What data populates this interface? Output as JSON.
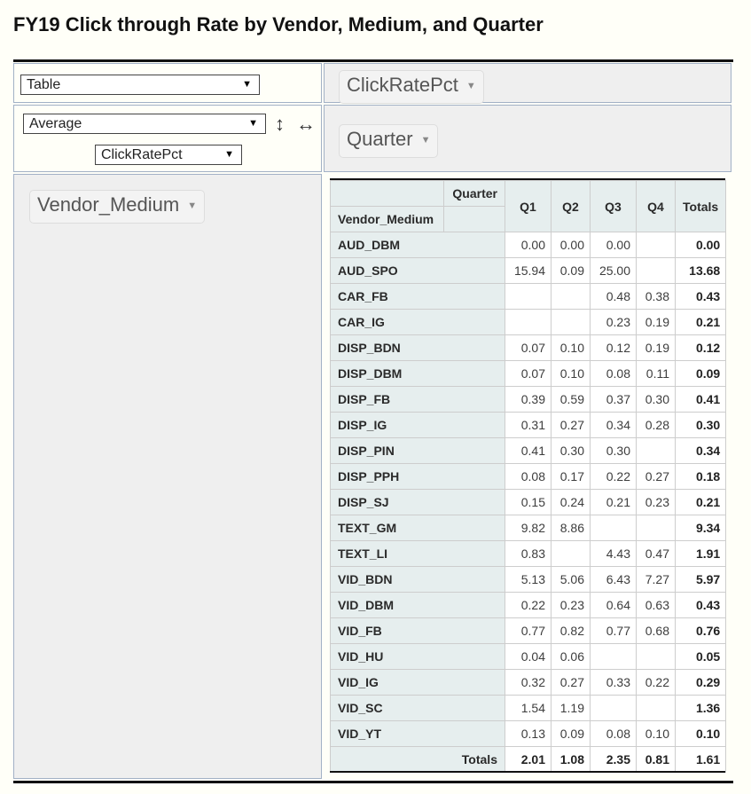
{
  "title": "FY19 Click through Rate by Vendor, Medium, and Quarter",
  "renderer": {
    "selected": "Table"
  },
  "aggregator": {
    "selected": "Average",
    "attribute": "ClickRatePct",
    "row_sort_icon": "↕",
    "col_sort_icon": "↔"
  },
  "unused_attrs": [
    {
      "label": "ClickRatePct"
    }
  ],
  "cols_attrs": [
    {
      "label": "Quarter"
    }
  ],
  "rows_attrs": [
    {
      "label": "Vendor_Medium"
    }
  ],
  "table": {
    "col_attr_label": "Quarter",
    "row_attr_label": "Vendor_Medium",
    "columns": [
      "Q1",
      "Q2",
      "Q3",
      "Q4"
    ],
    "totals_label": "Totals",
    "rows": [
      {
        "label": "AUD_DBM",
        "cells": [
          "0.00",
          "0.00",
          "0.00",
          ""
        ],
        "total": "0.00"
      },
      {
        "label": "AUD_SPO",
        "cells": [
          "15.94",
          "0.09",
          "25.00",
          ""
        ],
        "total": "13.68"
      },
      {
        "label": "CAR_FB",
        "cells": [
          "",
          "",
          "0.48",
          "0.38"
        ],
        "total": "0.43"
      },
      {
        "label": "CAR_IG",
        "cells": [
          "",
          "",
          "0.23",
          "0.19"
        ],
        "total": "0.21"
      },
      {
        "label": "DISP_BDN",
        "cells": [
          "0.07",
          "0.10",
          "0.12",
          "0.19"
        ],
        "total": "0.12"
      },
      {
        "label": "DISP_DBM",
        "cells": [
          "0.07",
          "0.10",
          "0.08",
          "0.11"
        ],
        "total": "0.09"
      },
      {
        "label": "DISP_FB",
        "cells": [
          "0.39",
          "0.59",
          "0.37",
          "0.30"
        ],
        "total": "0.41"
      },
      {
        "label": "DISP_IG",
        "cells": [
          "0.31",
          "0.27",
          "0.34",
          "0.28"
        ],
        "total": "0.30"
      },
      {
        "label": "DISP_PIN",
        "cells": [
          "0.41",
          "0.30",
          "0.30",
          ""
        ],
        "total": "0.34"
      },
      {
        "label": "DISP_PPH",
        "cells": [
          "0.08",
          "0.17",
          "0.22",
          "0.27"
        ],
        "total": "0.18"
      },
      {
        "label": "DISP_SJ",
        "cells": [
          "0.15",
          "0.24",
          "0.21",
          "0.23"
        ],
        "total": "0.21"
      },
      {
        "label": "TEXT_GM",
        "cells": [
          "9.82",
          "8.86",
          "",
          ""
        ],
        "total": "9.34"
      },
      {
        "label": "TEXT_LI",
        "cells": [
          "0.83",
          "",
          "4.43",
          "0.47"
        ],
        "total": "1.91"
      },
      {
        "label": "VID_BDN",
        "cells": [
          "5.13",
          "5.06",
          "6.43",
          "7.27"
        ],
        "total": "5.97"
      },
      {
        "label": "VID_DBM",
        "cells": [
          "0.22",
          "0.23",
          "0.64",
          "0.63"
        ],
        "total": "0.43"
      },
      {
        "label": "VID_FB",
        "cells": [
          "0.77",
          "0.82",
          "0.77",
          "0.68"
        ],
        "total": "0.76"
      },
      {
        "label": "VID_HU",
        "cells": [
          "0.04",
          "0.06",
          "",
          ""
        ],
        "total": "0.05"
      },
      {
        "label": "VID_IG",
        "cells": [
          "0.32",
          "0.27",
          "0.33",
          "0.22"
        ],
        "total": "0.29"
      },
      {
        "label": "VID_SC",
        "cells": [
          "1.54",
          "1.19",
          "",
          ""
        ],
        "total": "1.36"
      },
      {
        "label": "VID_YT",
        "cells": [
          "0.13",
          "0.09",
          "0.08",
          "0.10"
        ],
        "total": "0.10"
      }
    ],
    "col_totals": [
      "2.01",
      "1.08",
      "2.35",
      "0.81"
    ],
    "grand_total": "1.61"
  }
}
